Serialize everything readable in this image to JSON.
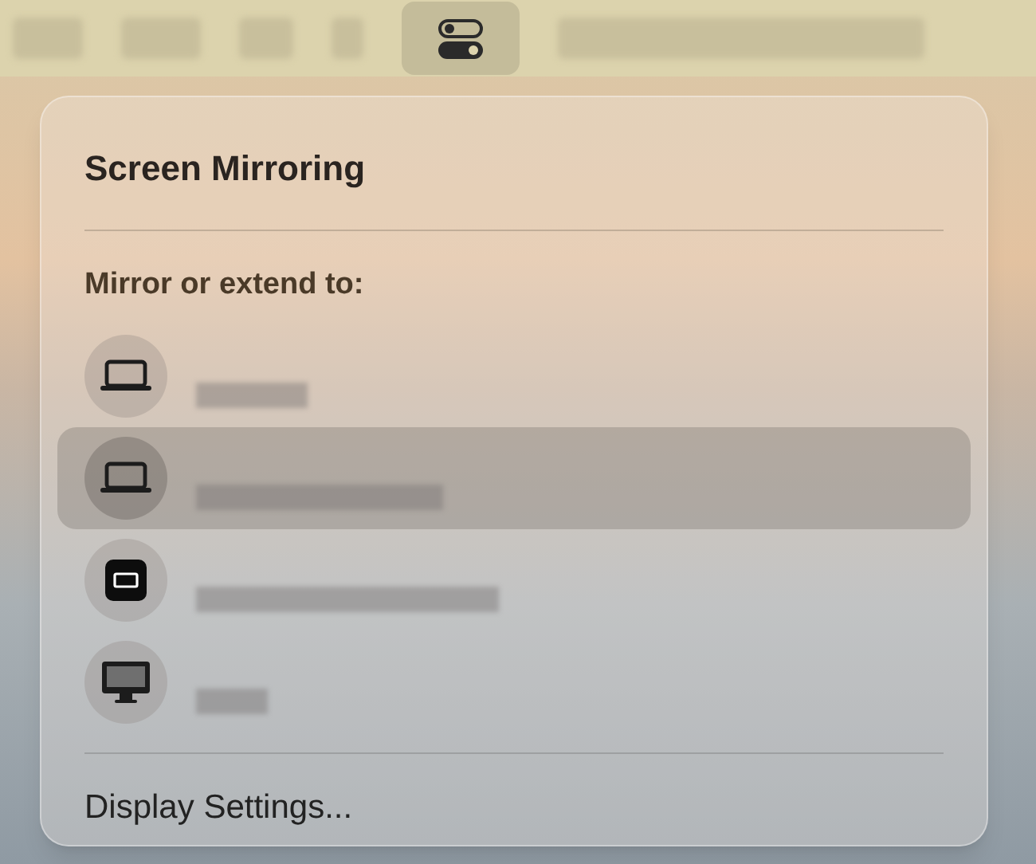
{
  "menu_bar": {
    "control_center_selected": true
  },
  "panel": {
    "title": "Screen Mirroring",
    "section_label": "Mirror or extend to:",
    "devices": [
      {
        "kind": "laptop",
        "selected": false
      },
      {
        "kind": "laptop",
        "selected": true
      },
      {
        "kind": "tv",
        "selected": false
      },
      {
        "kind": "display",
        "selected": false
      }
    ],
    "footer_item": "Display Settings..."
  }
}
